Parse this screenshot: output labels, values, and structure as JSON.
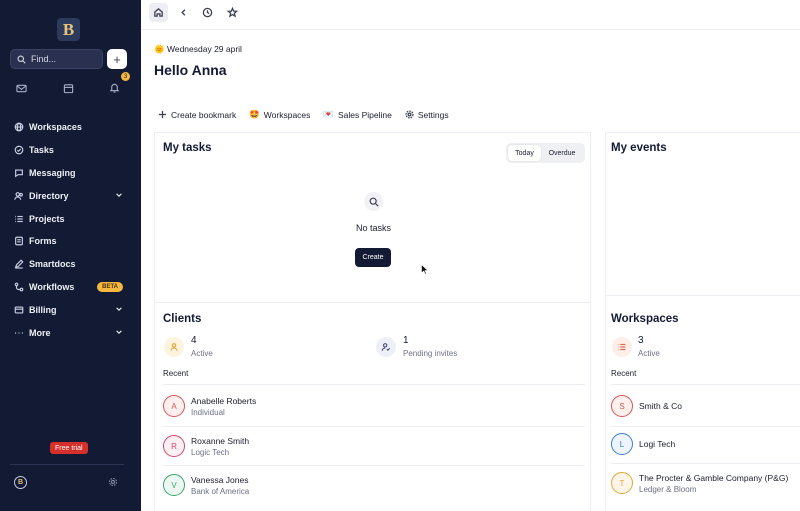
{
  "sidebar": {
    "logo_letter": "B",
    "find_placeholder": "Find...",
    "notification_count": "3",
    "items": [
      {
        "label": "Workspaces",
        "icon": "globe-icon"
      },
      {
        "label": "Tasks",
        "icon": "check-circle-icon"
      },
      {
        "label": "Messaging",
        "icon": "chat-icon"
      },
      {
        "label": "Directory",
        "icon": "users-icon",
        "has_chevron": true
      },
      {
        "label": "Projects",
        "icon": "list-icon"
      },
      {
        "label": "Forms",
        "icon": "form-icon"
      },
      {
        "label": "Smartdocs",
        "icon": "pen-icon"
      },
      {
        "label": "Workflows",
        "icon": "workflow-icon",
        "badge": "BETA"
      },
      {
        "label": "Billing",
        "icon": "card-icon",
        "has_chevron": true
      },
      {
        "label": "More",
        "icon": "dots-icon",
        "has_chevron": true
      }
    ],
    "free_trial": "Free trial",
    "avatar_letter": "B"
  },
  "header": {
    "date": "Wednesday 29 april",
    "date_emoji": "🌞",
    "greeting": "Hello Anna"
  },
  "shortcuts": [
    {
      "label": "Create bookmark",
      "icon": "plus-icon"
    },
    {
      "label": "Workspaces",
      "emoji": "🤩"
    },
    {
      "label": "Sales Pipeline",
      "emoji": "💌"
    },
    {
      "label": "Settings",
      "icon": "gear-icon"
    }
  ],
  "tasks": {
    "title": "My tasks",
    "tab_today": "Today",
    "tab_overdue": "Overdue",
    "empty_text": "No tasks",
    "create_label": "Create"
  },
  "events": {
    "title": "My events"
  },
  "clients": {
    "title": "Clients",
    "active_count": "4",
    "active_label": "Active",
    "pending_count": "1",
    "pending_label": "Pending invites",
    "recent_label": "Recent",
    "rows": [
      {
        "initial": "A",
        "name": "Anabelle Roberts",
        "sub": "Individual",
        "color": "#d9534f"
      },
      {
        "initial": "R",
        "name": "Roxanne Smith",
        "sub": "Logic Tech",
        "color": "#d9456a"
      },
      {
        "initial": "V",
        "name": "Vanessa Jones",
        "sub": "Bank of America",
        "color": "#3aa66b"
      }
    ]
  },
  "workspaces": {
    "title": "Workspaces",
    "active_count": "3",
    "active_label": "Active",
    "recent_label": "Recent",
    "rows": [
      {
        "initial": "S",
        "name": "Smith & Co",
        "sub": "",
        "color": "#d9534f"
      },
      {
        "initial": "L",
        "name": "Logi Tech",
        "sub": "",
        "color": "#3b7bd6"
      },
      {
        "initial": "T",
        "name": "The Procter & Gamble Company (P&G)",
        "sub": "Ledger & Bloom",
        "color": "#e0a73a"
      }
    ]
  }
}
